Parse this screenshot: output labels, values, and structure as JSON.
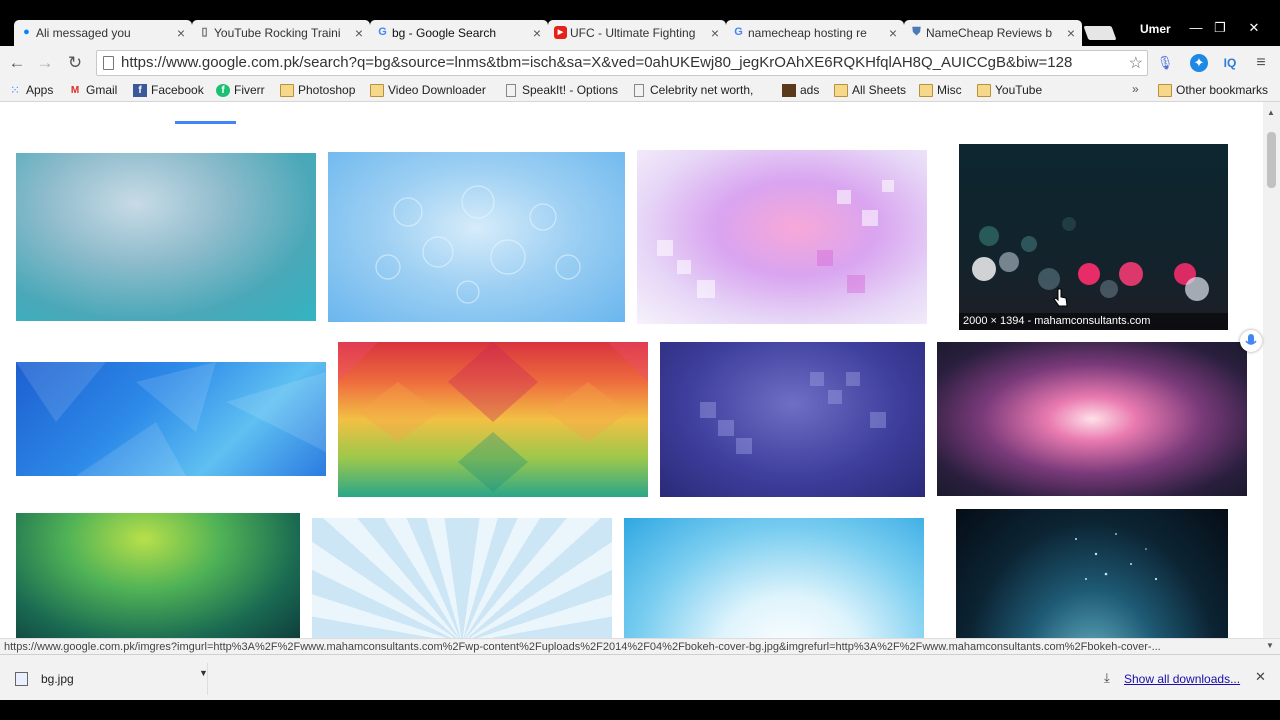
{
  "tabs": [
    {
      "title": "Ali messaged you",
      "icon": "messenger-icon",
      "color": "#0084ff"
    },
    {
      "title": "YouTube Rocking Traini",
      "icon": "page-icon",
      "color": "#666666"
    },
    {
      "title": "bg - Google Search",
      "icon": "google-icon",
      "color": "#4285f4"
    },
    {
      "title": "UFC - Ultimate Fighting",
      "icon": "youtube-icon",
      "color": "#e62117"
    },
    {
      "title": "namecheap hosting re",
      "icon": "google-icon",
      "color": "#4285f4"
    },
    {
      "title": "NameCheap Reviews b",
      "icon": "shield-icon",
      "color": "#4a7bb5"
    }
  ],
  "user": "Umer",
  "url": "https://www.google.com.pk/search?q=bg&source=lnms&tbm=isch&sa=X&ved=0ahUKEwj80_jegKrOAhXE6RQKHfqlAH8Q_AUICCgB&biw=128",
  "bookmarks": [
    {
      "label": "Apps",
      "icon": "apps-icon"
    },
    {
      "label": "Gmail",
      "icon": "gmail-icon"
    },
    {
      "label": "Facebook",
      "icon": "facebook-icon"
    },
    {
      "label": "Fiverr",
      "icon": "fiverr-icon"
    },
    {
      "label": "Photoshop",
      "icon": "folder-icon"
    },
    {
      "label": "Video Downloader",
      "icon": "folder-icon"
    },
    {
      "label": "SpeakIt! - Options",
      "icon": "page-icon"
    },
    {
      "label": "Celebrity net worth, ",
      "icon": "page-icon"
    },
    {
      "label": "ads",
      "icon": "image-icon"
    },
    {
      "label": "All Sheets",
      "icon": "folder-icon"
    },
    {
      "label": "Misc",
      "icon": "folder-icon"
    },
    {
      "label": "YouTube",
      "icon": "folder-icon"
    },
    {
      "label": "Other bookmarks",
      "icon": "folder-icon"
    }
  ],
  "images": [
    {
      "name": "image-result-blue-blur"
    },
    {
      "name": "image-result-blue-damask"
    },
    {
      "name": "image-result-pink-abstract"
    },
    {
      "name": "image-result-bokeh",
      "caption": "2000 × 1394 - mahamconsultants.com"
    },
    {
      "name": "image-result-blue-polygon"
    },
    {
      "name": "image-result-rainbow-geometric"
    },
    {
      "name": "image-result-purple-squares"
    },
    {
      "name": "image-result-pink-flare"
    },
    {
      "name": "image-result-green-gradient"
    },
    {
      "name": "image-result-light-blue-rays"
    },
    {
      "name": "image-result-light-blue-burst"
    },
    {
      "name": "image-result-earth-space"
    }
  ],
  "status_url": "https://www.google.com.pk/imgres?imgurl=http%3A%2F%2Fwww.mahamconsultants.com%2Fwp-content%2Fuploads%2F2014%2F04%2Fbokeh-cover-bg.jpg&imgrefurl=http%3A%2F%2Fwww.mahamconsultants.com%2Fbokeh-cover-...",
  "download": {
    "filename": "bg.jpg"
  },
  "show_all_downloads": "Show all downloads..."
}
